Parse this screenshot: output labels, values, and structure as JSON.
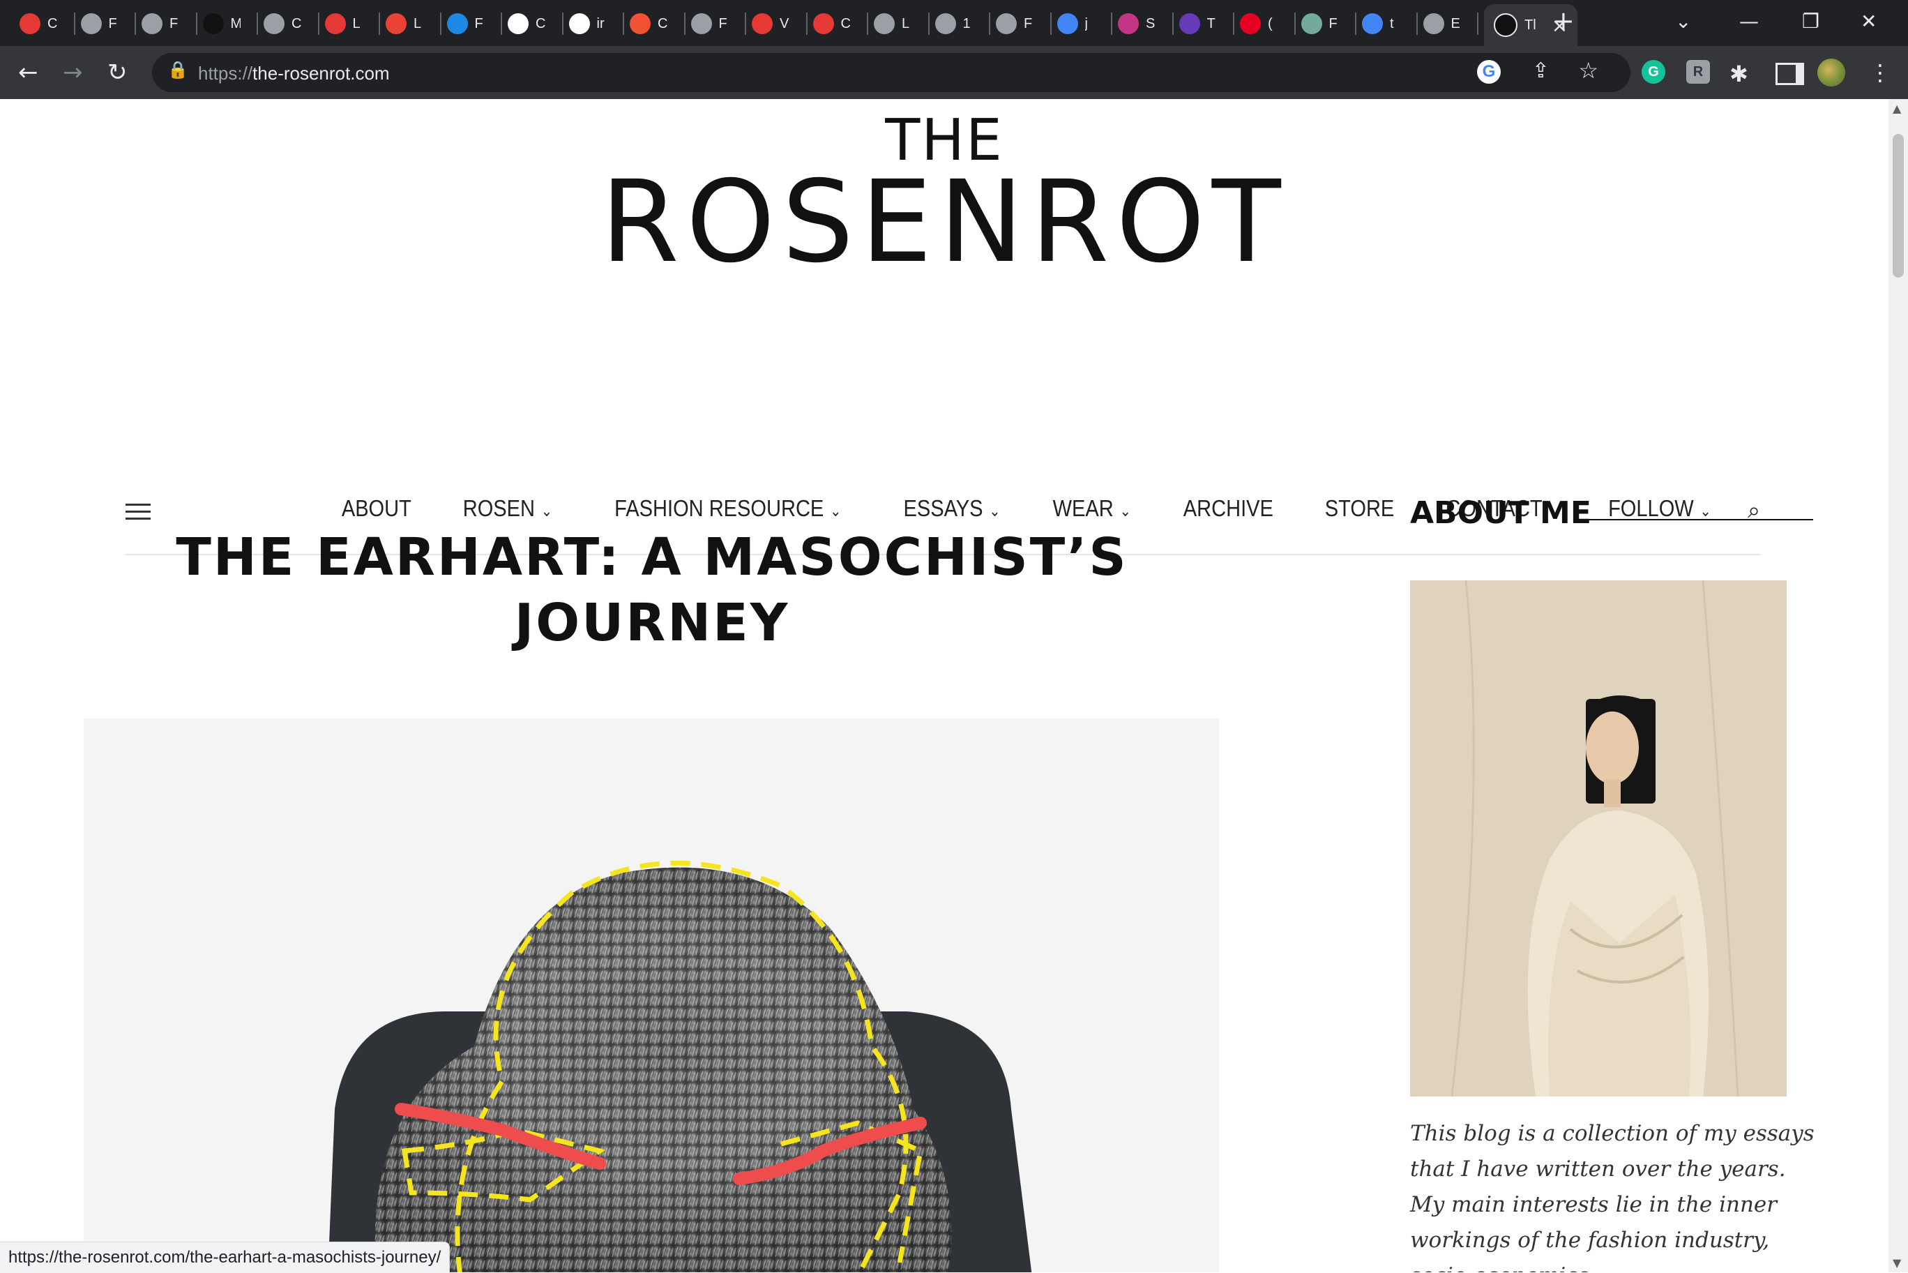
{
  "browser": {
    "tabs": [
      {
        "short": "C",
        "icon": "shield-icon",
        "color": "#e53935"
      },
      {
        "short": "F",
        "icon": "globe-icon",
        "color": "#9aa0a6"
      },
      {
        "short": "F",
        "icon": "globe-icon",
        "color": "#9aa0a6"
      },
      {
        "short": "M",
        "icon": "markdown-icon",
        "color": "#111111"
      },
      {
        "short": "C",
        "icon": "globe-icon",
        "color": "#9aa0a6"
      },
      {
        "short": "L",
        "icon": "shield-icon",
        "color": "#e53935"
      },
      {
        "short": "L",
        "icon": "gmail-icon",
        "color": "#ea4335"
      },
      {
        "short": "F",
        "icon": "xm-icon",
        "color": "#1e88e5"
      },
      {
        "short": "C",
        "icon": "github-icon",
        "color": "#ffffff"
      },
      {
        "short": "ir",
        "icon": "github-icon",
        "color": "#ffffff"
      },
      {
        "short": "C",
        "icon": "git-icon",
        "color": "#f05133"
      },
      {
        "short": "F",
        "icon": "globe-icon",
        "color": "#9aa0a6"
      },
      {
        "short": "V",
        "icon": "shield-icon",
        "color": "#e53935"
      },
      {
        "short": "C",
        "icon": "shield-icon",
        "color": "#e53935"
      },
      {
        "short": "L",
        "icon": "globe-icon",
        "color": "#9aa0a6"
      },
      {
        "short": "1",
        "icon": "globe-icon",
        "color": "#9aa0a6"
      },
      {
        "short": "F",
        "icon": "globe-icon",
        "color": "#9aa0a6"
      },
      {
        "short": "j",
        "icon": "google-icon",
        "color": "#4285f4"
      },
      {
        "short": "S",
        "icon": "instagram-icon",
        "color": "#c13584"
      },
      {
        "short": "T",
        "icon": "list-icon",
        "color": "#673ab7"
      },
      {
        "short": "(",
        "icon": "pinterest-icon",
        "color": "#e60023"
      },
      {
        "short": "F",
        "icon": "openai-icon",
        "color": "#74aa9c"
      },
      {
        "short": "t",
        "icon": "docs-icon",
        "color": "#4285f4"
      },
      {
        "short": "E",
        "icon": "cube-icon",
        "color": "#9aa0a6"
      }
    ],
    "active_tab": {
      "short": "Tl"
    },
    "url_scheme": "https://",
    "url_host": "the-rosenrot.com",
    "status_url": "https://the-rosenrot.com/the-earhart-a-masochists-journey/"
  },
  "site": {
    "logo_top": "THE",
    "logo_main": "ROSENROT",
    "nav": [
      {
        "label": "ABOUT",
        "dropdown": false
      },
      {
        "label": "ROSEN",
        "dropdown": true
      },
      {
        "label": "FASHION RESOURCE",
        "dropdown": true
      },
      {
        "label": "ESSAYS",
        "dropdown": true
      },
      {
        "label": "WEAR",
        "dropdown": true
      },
      {
        "label": "ARCHIVE",
        "dropdown": false
      },
      {
        "label": "STORE",
        "dropdown": false
      },
      {
        "label": "CONTACT",
        "dropdown": false
      }
    ],
    "follow_label": "FOLLOW"
  },
  "post": {
    "title": "THE EARHART: A MASOCHIST’S JOURNEY"
  },
  "sidebar": {
    "heading": "ABOUT ME",
    "about_text": "This blog is a collection of my essays that I have written over the years. My main interests lie in the inner workings of the fashion industry, socio-economics"
  }
}
